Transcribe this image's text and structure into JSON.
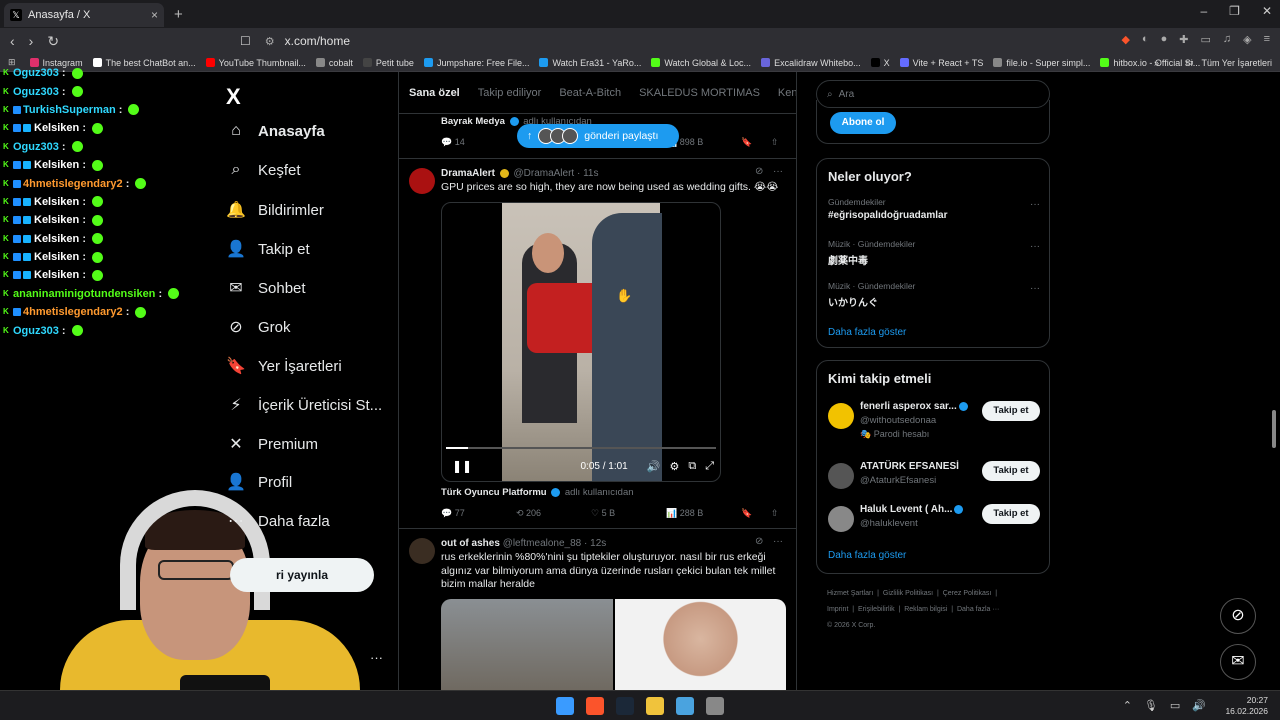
{
  "browser": {
    "tab_title": "Anasayfa / X",
    "tab_close": "×",
    "new_tab": "+",
    "url": "x.com/home",
    "window_controls": [
      "–",
      "❐",
      "✕"
    ],
    "bookmarks": [
      {
        "label": "Instagram",
        "color": "#e1306c"
      },
      {
        "label": "The best ChatBot an...",
        "color": "#ffffff"
      },
      {
        "label": "YouTube Thumbnail...",
        "color": "#ff0000"
      },
      {
        "label": "cobalt",
        "color": "#888888"
      },
      {
        "label": "Petit tube",
        "color": "#444444"
      },
      {
        "label": "Jumpshare: Free File...",
        "color": "#1d9bf0"
      },
      {
        "label": "Watch Era31 - YaRo...",
        "color": "#1d9bf0"
      },
      {
        "label": "Watch Global & Loc...",
        "color": "#53fc18"
      },
      {
        "label": "Excalidraw Whitebo...",
        "color": "#6965db"
      },
      {
        "label": "X",
        "color": "#000000"
      },
      {
        "label": "Vite + React + TS",
        "color": "#646cff"
      },
      {
        "label": "file.io - Super simpl...",
        "color": "#888888"
      },
      {
        "label": "hitbox.io - Official Si...",
        "color": "#53fc18"
      }
    ],
    "bookmarks_overflow": "»",
    "all_bookmarks": "Tüm Yer İşaretleri"
  },
  "chat": {
    "messages": [
      {
        "user": "Oguz303",
        "color": "#2fd9ff",
        "badges": 1
      },
      {
        "user": "Oguz303",
        "color": "#2fd9ff",
        "badges": 1
      },
      {
        "user": "TurkishSuperman",
        "color": "#2fd9ff",
        "badges": 2
      },
      {
        "user": "Kelsiken",
        "color": "#ffffff",
        "badges": 3
      },
      {
        "user": "Oguz303",
        "color": "#2fd9ff",
        "badges": 1
      },
      {
        "user": "Kelsiken",
        "color": "#ffffff",
        "badges": 3
      },
      {
        "user": "4hmetislegendary2",
        "color": "#ff9a2f",
        "badges": 2
      },
      {
        "user": "Kelsiken",
        "color": "#ffffff",
        "badges": 3
      },
      {
        "user": "Kelsiken",
        "color": "#ffffff",
        "badges": 3
      },
      {
        "user": "Kelsiken",
        "color": "#ffffff",
        "badges": 3
      },
      {
        "user": "Kelsiken",
        "color": "#ffffff",
        "badges": 3
      },
      {
        "user": "Kelsiken",
        "color": "#ffffff",
        "badges": 3
      },
      {
        "user": "ananinaminigotundensiken",
        "color": "#53fc18",
        "badges": 1
      },
      {
        "user": "4hmetislegendary2",
        "color": "#ff9a2f",
        "badges": 2
      },
      {
        "user": "Oguz303",
        "color": "#2fd9ff",
        "badges": 1
      }
    ],
    "separator": ":"
  },
  "x_nav": {
    "logo": "X",
    "items": [
      {
        "label": "Anasayfa",
        "icon": "home-icon",
        "glyph": "⌂"
      },
      {
        "label": "Keşfet",
        "icon": "search-icon",
        "glyph": "⌕"
      },
      {
        "label": "Bildirimler",
        "icon": "bell-icon",
        "glyph": "🔔"
      },
      {
        "label": "Takip et",
        "icon": "add-person-icon",
        "glyph": "👤"
      },
      {
        "label": "Sohbet",
        "icon": "mail-icon",
        "glyph": "✉"
      },
      {
        "label": "Grok",
        "icon": "grok-icon",
        "glyph": "⊘"
      },
      {
        "label": "Yer İşaretleri",
        "icon": "bookmark-icon",
        "glyph": "🔖"
      },
      {
        "label": "İçerik Üreticisi St...",
        "icon": "lightning-icon",
        "glyph": "⚡"
      },
      {
        "label": "Premium",
        "icon": "x-premium-icon",
        "glyph": "✕"
      },
      {
        "label": "Profil",
        "icon": "profile-icon",
        "glyph": "👤"
      },
      {
        "label": "Daha fazla",
        "icon": "more-icon",
        "glyph": "⋯"
      }
    ],
    "post_button_visible": "ri yayınla",
    "account_more": "···"
  },
  "feed": {
    "tabs": [
      "Sana özel",
      "Takip ediliyor",
      "Beat-A-Bitch",
      "SKALEDUS MORTIMAS",
      "Kend"
    ],
    "share_pill": "gönderi paylaştı",
    "top_post": {
      "source": "Bayrak Medya",
      "source_suffix": "adlı kullanıcıdan",
      "replies": "14",
      "reposts": "",
      "likes": "",
      "views": "898 B"
    },
    "post1": {
      "name": "DramaAlert",
      "handle": "@DramaAlert",
      "time": "11s",
      "text": "GPU prices are so high, they are now being used as wedding gifts. 😭😭",
      "video_time": "0:05 / 1:01",
      "video_progress": 0.08,
      "source": "Türk Oyuncu Platformu",
      "source_suffix": "adlı kullanıcıdan",
      "replies": "77",
      "reposts": "206",
      "likes": "5 B",
      "views": "288 B"
    },
    "post2": {
      "name": "out of ashes",
      "handle": "@leftmealone_88",
      "time": "12s",
      "text": "rus erkeklerinin %80%'nini şu tiptekiler oluşturuyor. nasıl bir rus erkeği algınız var bilmiyorum ama dünya üzerinde rusları çekici bulan tek millet bizim mallar heralde"
    },
    "more_dots": "···"
  },
  "right": {
    "search_placeholder": "Ara",
    "subscribe_button": "Abone ol",
    "trends_title": "Neler oluyor?",
    "trends": [
      {
        "category": "Gündemdekiler",
        "name": "#eğrisopalıdoğruadamlar"
      },
      {
        "category": "Müzik · Gündemdekiler",
        "name": "劇薬中毒"
      },
      {
        "category": "Müzik · Gündemdekiler",
        "name": "いかりんぐ"
      }
    ],
    "show_more": "Daha fazla göster",
    "who_title": "Kimi takip etmeli",
    "who": [
      {
        "name": "fenerli asperox sar...",
        "handle": "@withoutsedonaa",
        "note": "🎭 Parodi hesabı",
        "button": "Takip et"
      },
      {
        "name": "ATATÜRK EFSANESİ",
        "handle": "@AtaturkEfsanesi",
        "note": "",
        "button": "Takip et"
      },
      {
        "name": "Haluk Levent ( Ah...",
        "handle": "@haluklevent",
        "note": "",
        "button": "Takip et"
      }
    ],
    "who_more": "Daha fazla göster",
    "footer_links": [
      "Hizmet Şartları",
      "Gizlilik Politikası",
      "Çerez Politikası",
      "Imprint",
      "Erişilebilirlik",
      "Reklam bilgisi",
      "Daha fazla ···"
    ],
    "copyright": "© 2026 X Corp."
  },
  "taskbar": {
    "time": "20:27",
    "date": "16.02.2026"
  }
}
